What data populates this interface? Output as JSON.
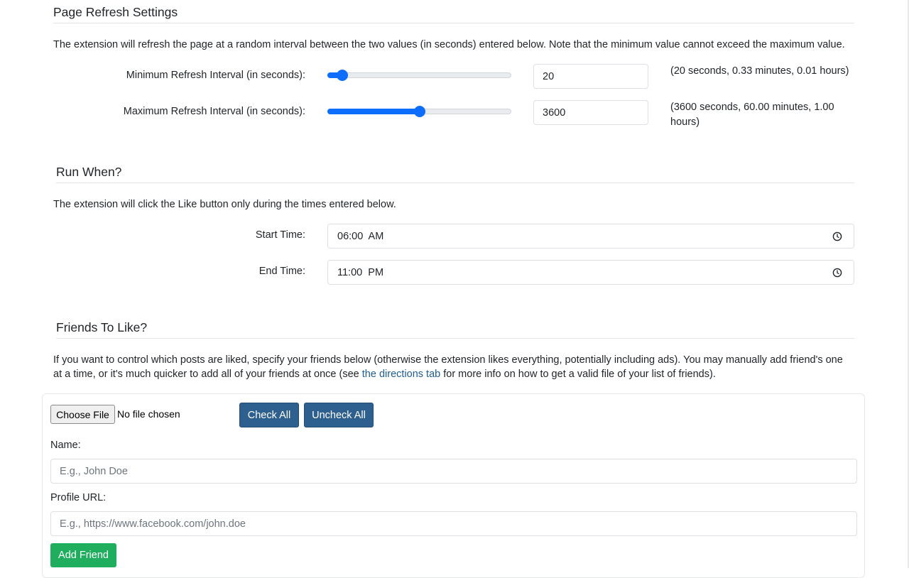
{
  "refresh": {
    "title": "Page Refresh Settings",
    "description": "The extension will refresh the page at a random interval between the two values (in seconds) entered below. Note that the minimum value cannot exceed the maximum value.",
    "min": {
      "label": "Minimum Refresh Interval (in seconds):",
      "value": "20",
      "slider_fraction": 0.08,
      "note": "(20 seconds, 0.33 minutes, 0.01 hours)"
    },
    "max": {
      "label": "Maximum Refresh Interval (in seconds):",
      "value": "3600",
      "slider_fraction": 0.5,
      "note_line1": "(3600 seconds, 60.00 minutes, 1.00",
      "note_line2": "hours)"
    }
  },
  "run_when": {
    "title": "Run When?",
    "description": "The extension will click the Like button only during the times entered below.",
    "start": {
      "label": "Start Time:",
      "value": "06:00  AM"
    },
    "end": {
      "label": "End Time:",
      "value": "11:00  PM"
    }
  },
  "friends": {
    "title": "Friends To Like?",
    "description_line1": "If you want to control which posts are liked, specify your friends below (otherwise the extension likes everything, potentially including ads). You may manually add friend's one",
    "description_line2_pre": "at a time, or it's much quicker to add all of your friends at once (see ",
    "directions_link": "the directions tab",
    "description_line2_post": " for more info on how to get a valid file of your list of friends).",
    "choose_file_label": "Choose File",
    "no_file_text": "No file chosen",
    "check_all_label": "Check All",
    "uncheck_all_label": "Uncheck All",
    "name_label": "Name:",
    "name_placeholder": "E.g., John Doe",
    "url_label": "Profile URL:",
    "url_placeholder": "E.g., https://www.facebook.com/john.doe",
    "add_friend_label": "Add Friend"
  },
  "colors": {
    "accent": "#0d6efd",
    "button_dark": "#2d5f8f",
    "button_green": "#1fae5e",
    "link": "#1d5c92"
  },
  "icons": {
    "time_picker": "clock-icon"
  }
}
